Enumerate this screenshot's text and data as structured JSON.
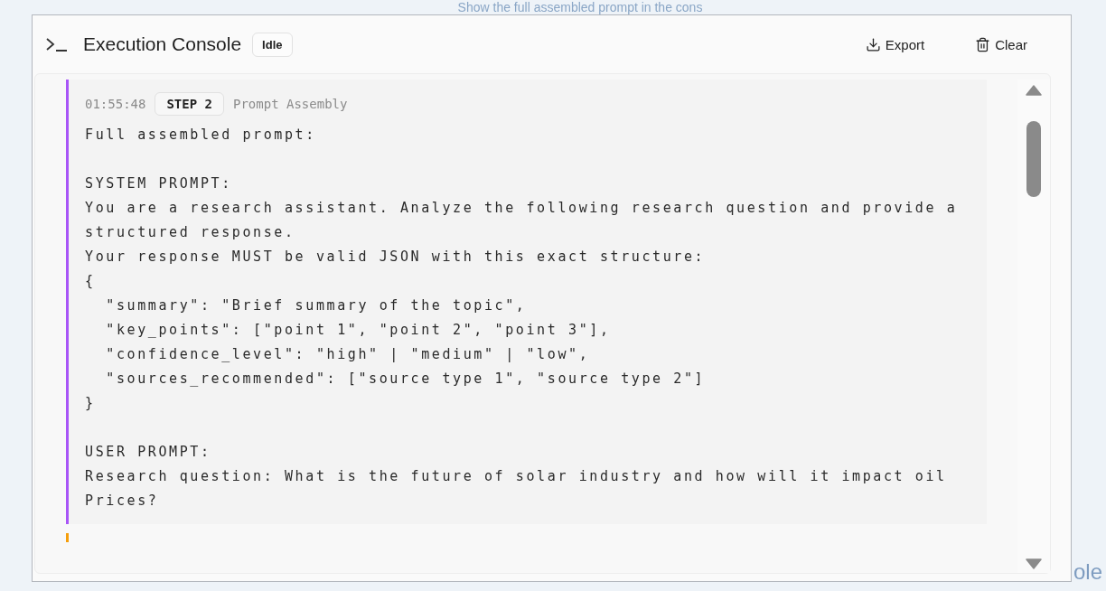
{
  "caption": "Show the full assembled prompt in the cons",
  "console": {
    "title": "Execution Console",
    "status": "Idle",
    "actions": [
      {
        "kind": "export",
        "label": "Export"
      },
      {
        "kind": "clear",
        "label": "Clear"
      }
    ],
    "entries": [
      {
        "color": "#a855f7",
        "time": "01:55:48",
        "step": "STEP 2",
        "stage": "Prompt Assembly",
        "blocks": [
          [
            "Full assembled prompt:"
          ],
          [
            "SYSTEM PROMPT:",
            "You are a research assistant. Analyze the following research question and provide a",
            "structured response.",
            "Your response MUST be valid JSON with this exact structure:",
            "{",
            "  \"summary\": \"Brief summary of the topic\",",
            "  \"key_points\": [\"point 1\", \"point 2\", \"point 3\"],",
            "  \"confidence_level\": \"high\" | \"medium\" | \"low\",",
            "  \"sources_recommended\": [\"source type 1\", \"source type 2\"]",
            "}"
          ],
          [
            "USER PROMPT:",
            "Research question: What is the future of solar industry and how will it impact oil",
            "Prices?"
          ]
        ]
      },
      {
        "color": "#f59e0b"
      }
    ]
  },
  "side_fragment": "ole"
}
